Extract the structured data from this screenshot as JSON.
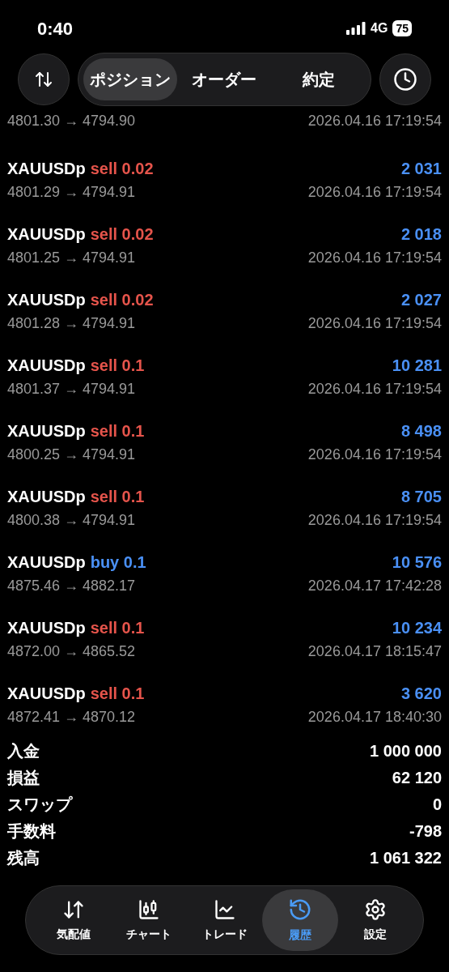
{
  "status_bar": {
    "time": "0:40",
    "network": "4G",
    "battery": "75"
  },
  "tabs": [
    {
      "label": "ポジション",
      "selected": true
    },
    {
      "label": "オーダー",
      "selected": false
    },
    {
      "label": "約定",
      "selected": false
    }
  ],
  "partial_row": {
    "prices": "4801.30 → 4794.90",
    "time": "2026.04.16 17:19:54"
  },
  "deals": [
    {
      "symbol": "XAUUSDp",
      "side": "sell",
      "volume": "0.02",
      "profit": "2 031",
      "prices": "4801.29 → 4794.91",
      "time": "2026.04.16 17:19:54"
    },
    {
      "symbol": "XAUUSDp",
      "side": "sell",
      "volume": "0.02",
      "profit": "2 018",
      "prices": "4801.25 → 4794.91",
      "time": "2026.04.16 17:19:54"
    },
    {
      "symbol": "XAUUSDp",
      "side": "sell",
      "volume": "0.02",
      "profit": "2 027",
      "prices": "4801.28 → 4794.91",
      "time": "2026.04.16 17:19:54"
    },
    {
      "symbol": "XAUUSDp",
      "side": "sell",
      "volume": "0.1",
      "profit": "10 281",
      "prices": "4801.37 → 4794.91",
      "time": "2026.04.16 17:19:54"
    },
    {
      "symbol": "XAUUSDp",
      "side": "sell",
      "volume": "0.1",
      "profit": "8 498",
      "prices": "4800.25 → 4794.91",
      "time": "2026.04.16 17:19:54"
    },
    {
      "symbol": "XAUUSDp",
      "side": "sell",
      "volume": "0.1",
      "profit": "8 705",
      "prices": "4800.38 → 4794.91",
      "time": "2026.04.16 17:19:54"
    },
    {
      "symbol": "XAUUSDp",
      "side": "buy",
      "volume": "0.1",
      "profit": "10 576",
      "prices": "4875.46 → 4882.17",
      "time": "2026.04.17 17:42:28"
    },
    {
      "symbol": "XAUUSDp",
      "side": "sell",
      "volume": "0.1",
      "profit": "10 234",
      "prices": "4872.00 → 4865.52",
      "time": "2026.04.17 18:15:47"
    },
    {
      "symbol": "XAUUSDp",
      "side": "sell",
      "volume": "0.1",
      "profit": "3 620",
      "prices": "4872.41 → 4870.12",
      "time": "2026.04.17 18:40:30"
    }
  ],
  "summary": [
    {
      "label": "入金",
      "value": "1 000 000"
    },
    {
      "label": "損益",
      "value": "62 120"
    },
    {
      "label": "スワップ",
      "value": "0"
    },
    {
      "label": "手数料",
      "value": "-798"
    },
    {
      "label": "残高",
      "value": "1 061 322"
    }
  ],
  "nav": [
    {
      "kind": "quotes",
      "label": "気配値",
      "selected": false
    },
    {
      "kind": "chart",
      "label": "チャート",
      "selected": false
    },
    {
      "kind": "trade",
      "label": "トレード",
      "selected": false
    },
    {
      "kind": "history",
      "label": "履歴",
      "selected": true
    },
    {
      "kind": "settings",
      "label": "設定",
      "selected": false
    }
  ]
}
